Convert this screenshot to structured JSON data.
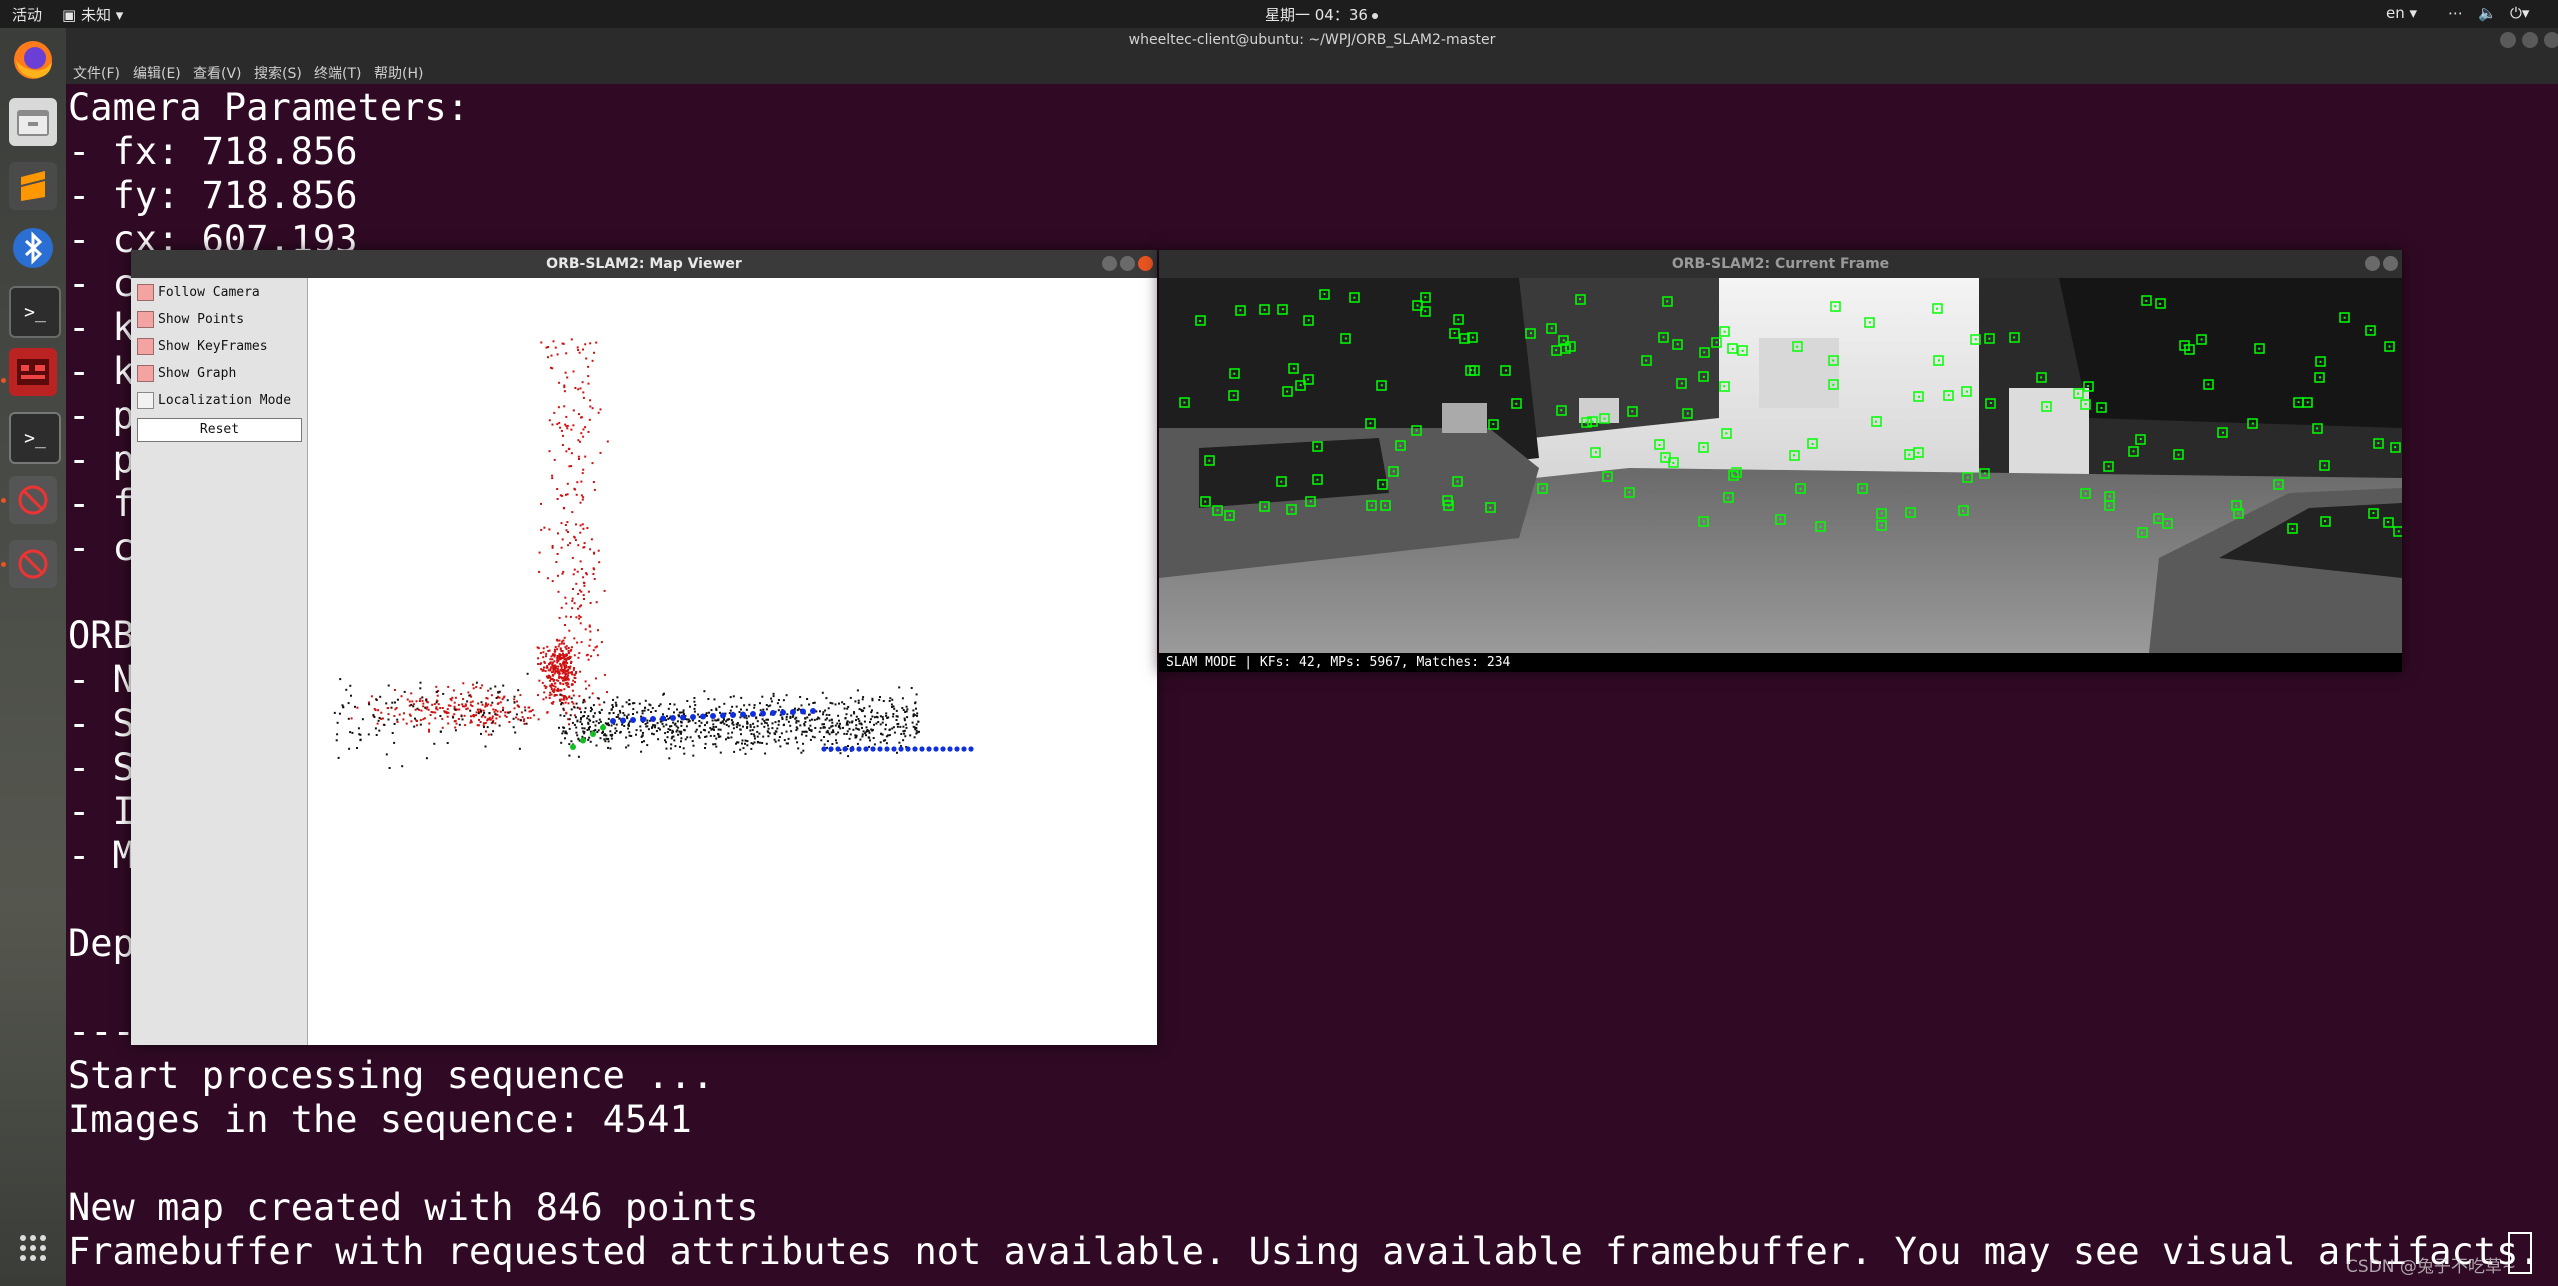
{
  "topbar": {
    "activities": "活动",
    "app_menu": "未知",
    "clock": "星期一 04：36",
    "input_method": "en"
  },
  "terminal": {
    "title": "wheeltec-client@ubuntu: ~/WPJ/ORB_SLAM2-master",
    "menu": [
      "文件(F)",
      "编辑(E)",
      "查看(V)",
      "搜索(S)",
      "终端(T)",
      "帮助(H)"
    ],
    "lines": [
      "Camera Parameters:",
      "- fx: 718.856",
      "- fy: 718.856",
      "- cx: 607.193",
      "- c",
      "- k",
      "- k",
      "- p",
      "- p",
      "- f",
      "- c",
      "",
      "ORB",
      "- N",
      "- S",
      "- S",
      "- I",
      "- M",
      "",
      "Dep",
      "",
      "---",
      "Start processing sequence ...",
      "Images in the sequence: 4541",
      "",
      "New map created with 846 points",
      "Framebuffer with requested attributes not available. Using available framebuffer. You may see visual artifacts."
    ]
  },
  "map_viewer": {
    "title": "ORB-SLAM2: Map Viewer",
    "options": [
      {
        "label": "Follow Camera",
        "checked": true
      },
      {
        "label": "Show Points",
        "checked": true
      },
      {
        "label": "Show KeyFrames",
        "checked": true
      },
      {
        "label": "Show Graph",
        "checked": true
      },
      {
        "label": "Localization Mode",
        "checked": false
      }
    ],
    "reset_label": "Reset",
    "colors": {
      "map_points": "#d01010",
      "old_points": "#111111",
      "keyframes": "#1030e0",
      "graph": "#10c020"
    }
  },
  "current_frame": {
    "title": "ORB-SLAM2: Current Frame",
    "status": "SLAM MODE |  KFs: 42, MPs: 5967, Matches: 234",
    "feature_color": "#00ff00"
  },
  "watermark": "CSDN @兔子不吃草~"
}
